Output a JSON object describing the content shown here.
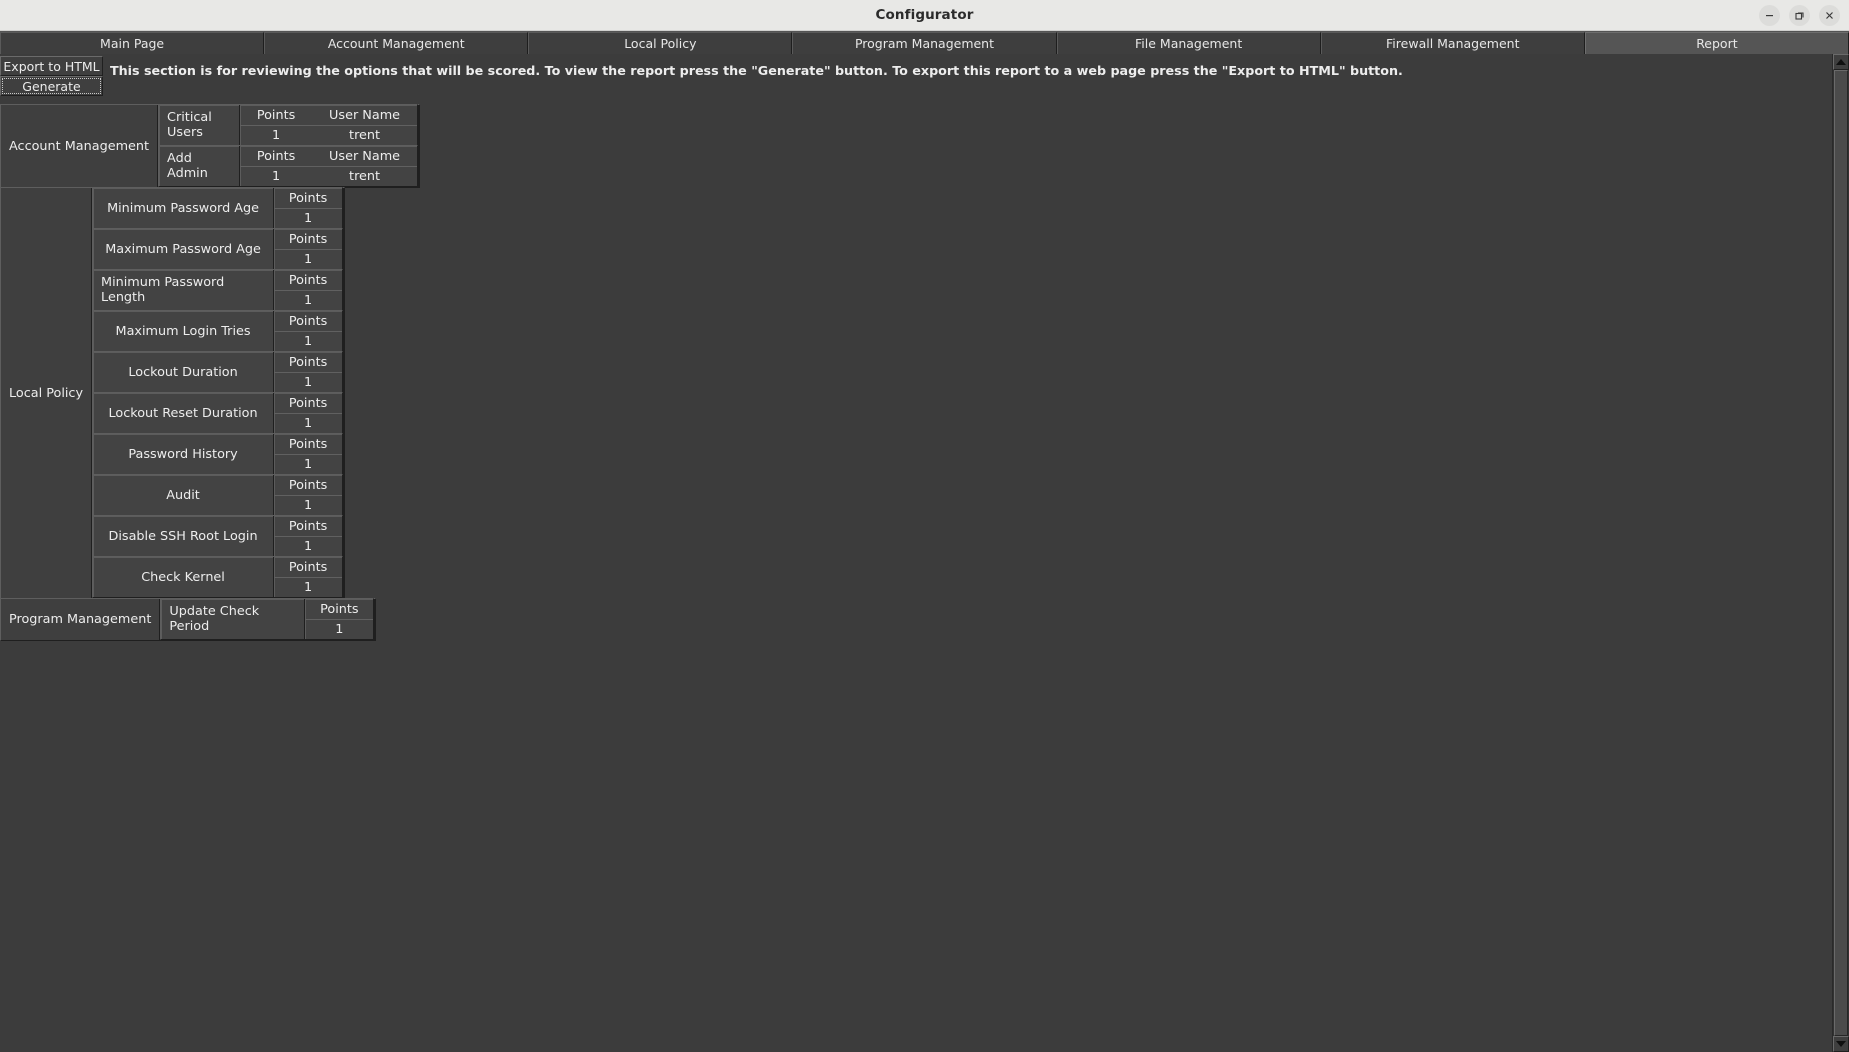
{
  "window": {
    "title": "Configurator",
    "controls": [
      {
        "name": "minimize-button",
        "icon": "minimize-icon"
      },
      {
        "name": "maximize-button",
        "icon": "maximize-icon"
      },
      {
        "name": "close-button",
        "icon": "close-icon"
      }
    ]
  },
  "tabs": [
    {
      "label": "Main Page",
      "selected": false
    },
    {
      "label": "Account Management",
      "selected": false
    },
    {
      "label": "Local Policy",
      "selected": false
    },
    {
      "label": "Program Management",
      "selected": false
    },
    {
      "label": "File Management",
      "selected": false
    },
    {
      "label": "Firewall Management",
      "selected": false
    },
    {
      "label": "Report",
      "selected": true
    }
  ],
  "toolbar": {
    "export_label": "Export to HTML",
    "generate_label": "Generate",
    "description": "This section is for reviewing the options that will be scored. To view the report press the \"Generate\" button. To export this report to a web page press the \"Export to HTML\" button."
  },
  "columns": {
    "points": "Points",
    "user_name": "User Name"
  },
  "sections": [
    {
      "label": "Account Management",
      "items": [
        {
          "label": "Critical Users",
          "headers": [
            "Points",
            "User Name"
          ],
          "values": [
            "1",
            "trent"
          ]
        },
        {
          "label": "Add Admin",
          "headers": [
            "Points",
            "User Name"
          ],
          "values": [
            "1",
            "trent"
          ]
        }
      ]
    },
    {
      "label": "Local Policy",
      "items": [
        {
          "label": "Minimum Password Age",
          "headers": [
            "Points"
          ],
          "values": [
            "1"
          ]
        },
        {
          "label": "Maximum Password Age",
          "headers": [
            "Points"
          ],
          "values": [
            "1"
          ]
        },
        {
          "label": "Minimum Password Length",
          "headers": [
            "Points"
          ],
          "values": [
            "1"
          ]
        },
        {
          "label": "Maximum Login Tries",
          "headers": [
            "Points"
          ],
          "values": [
            "1"
          ]
        },
        {
          "label": "Lockout Duration",
          "headers": [
            "Points"
          ],
          "values": [
            "1"
          ]
        },
        {
          "label": "Lockout Reset Duration",
          "headers": [
            "Points"
          ],
          "values": [
            "1"
          ]
        },
        {
          "label": "Password History",
          "headers": [
            "Points"
          ],
          "values": [
            "1"
          ]
        },
        {
          "label": "Audit",
          "headers": [
            "Points"
          ],
          "values": [
            "1"
          ]
        },
        {
          "label": "Disable SSH Root Login",
          "headers": [
            "Points"
          ],
          "values": [
            "1"
          ]
        },
        {
          "label": "Check Kernel",
          "headers": [
            "Points"
          ],
          "values": [
            "1"
          ]
        }
      ]
    },
    {
      "label": "Program Management",
      "items": [
        {
          "label": "Update Check Period",
          "headers": [
            "Points"
          ],
          "values": [
            "1"
          ]
        }
      ]
    }
  ],
  "scrollbar": {
    "up_icon": "arrow-up-icon",
    "down_icon": "arrow-down-icon"
  }
}
